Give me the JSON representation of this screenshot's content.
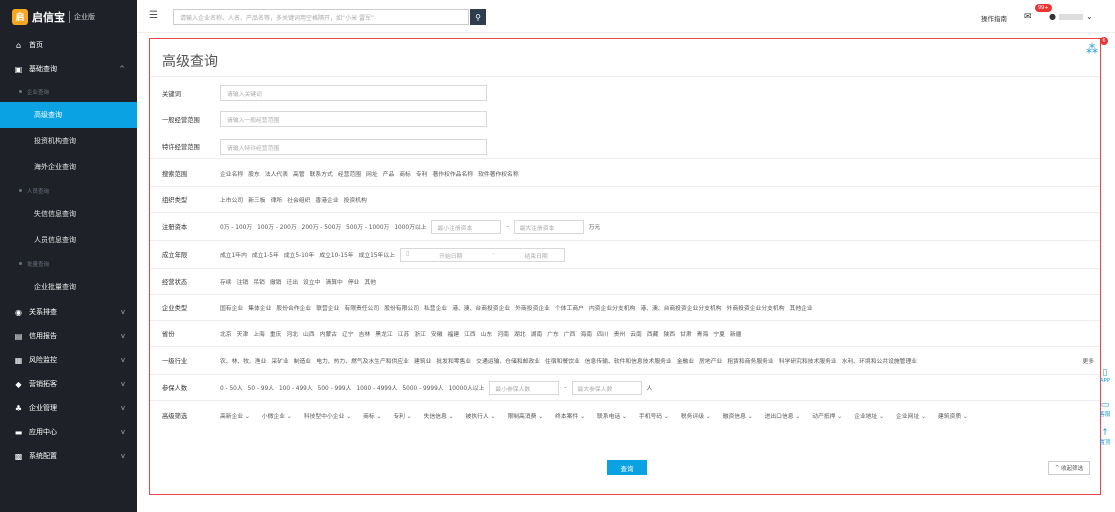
{
  "brand": {
    "name": "启信宝",
    "edition": "企业版",
    "logo": "启"
  },
  "sidebar": {
    "home": "首页",
    "basic": "基础查询",
    "group_company": "企业查询",
    "advanced": "高级查询",
    "investor": "投资机构查询",
    "overseas": "海外企业查询",
    "group_person": "人员查询",
    "dishonest": "失信信息查询",
    "person_info": "人员信息查询",
    "group_batch": "批量查询",
    "batch": "企业批量查询",
    "relation": "关系排查",
    "credit": "信用报告",
    "risk": "风险监控",
    "marketing": "营销拓客",
    "enterprise": "企业管理",
    "apps": "应用中心",
    "config": "系统配置"
  },
  "topbar": {
    "search_placeholder": "请输入企业名称、人名、产品名等，多关键词用空格隔开，如“小米 雷军”",
    "guide": "操作指南",
    "badge": "99+"
  },
  "page": {
    "title": "高级查询",
    "share_badge": "6"
  },
  "fields": {
    "keyword_label": "关键词",
    "keyword_ph": "请输入关键词",
    "scope_label": "一般经营范围",
    "scope_ph": "请输入一般经营范围",
    "license_label": "特许经营范围",
    "license_ph": "请输入特许经营范围"
  },
  "search_range": {
    "label": "搜索范围",
    "options": [
      "企业名称",
      "股东",
      "法人代表",
      "高管",
      "联系方式",
      "经营范围",
      "网址",
      "产品",
      "商标",
      "专利",
      "著作权作品名称",
      "软件著作权名称"
    ]
  },
  "org_type": {
    "label": "组织类型",
    "options": [
      "上市公司",
      "新三板",
      "律所",
      "社会组织",
      "香港企业",
      "投资机构"
    ]
  },
  "capital": {
    "label": "注册资本",
    "options": [
      "0万 - 100万",
      "100万 - 200万",
      "200万 - 500万",
      "500万 - 1000万",
      "1000万以上"
    ],
    "min_ph": "最小注册资本",
    "max_ph": "最大注册资本",
    "unit": "万元"
  },
  "founded": {
    "label": "成立年限",
    "options": [
      "成立1年内",
      "成立1-5年",
      "成立5-10年",
      "成立10-15年",
      "成立15年以上"
    ],
    "start_ph": "开始日期",
    "end_ph": "结束日期"
  },
  "status": {
    "label": "经营状态",
    "options": [
      "存续",
      "注销",
      "吊销",
      "撤销",
      "迁出",
      "设立中",
      "清算中",
      "停业",
      "其他"
    ]
  },
  "ent_type": {
    "label": "企业类型",
    "options": [
      "国有企业",
      "集体企业",
      "股份合作企业",
      "联营企业",
      "有限责任公司",
      "股份有限公司",
      "私营企业",
      "港、澳、台商投资企业",
      "外商投资企业",
      "个体工商户",
      "内资企业分支机构",
      "港、澳、台商投资企业分支机构",
      "外商投资企业分支机构",
      "其他企业"
    ]
  },
  "province": {
    "label": "省份",
    "options": [
      "北京",
      "天津",
      "上海",
      "重庆",
      "河北",
      "山西",
      "内蒙古",
      "辽宁",
      "吉林",
      "黑龙江",
      "江苏",
      "浙江",
      "安徽",
      "福建",
      "江西",
      "山东",
      "河南",
      "湖北",
      "湖南",
      "广东",
      "广西",
      "海南",
      "四川",
      "贵州",
      "云南",
      "西藏",
      "陕西",
      "甘肃",
      "青海",
      "宁夏",
      "新疆"
    ]
  },
  "industry": {
    "label": "一级行业",
    "options": [
      "农、林、牧、渔业",
      "采矿业",
      "制造业",
      "电力、热力、燃气及水生产和供应业",
      "建筑业",
      "批发和零售业",
      "交通运输、仓储和邮政业",
      "住宿和餐饮业",
      "信息传输、软件和信息技术服务业",
      "金融业",
      "房地产业",
      "租赁和商务服务业",
      "科学研究和技术服务业",
      "水利、环境和公共设施管理业"
    ],
    "more": "更多"
  },
  "staff": {
    "label": "参保人数",
    "options": [
      "0 - 50人",
      "50 - 99人",
      "100 - 499人",
      "500 - 999人",
      "1000 - 4999人",
      "5000 - 9999人",
      "10000人以上"
    ],
    "min_ph": "最小参保人数",
    "max_ph": "最大参保人数",
    "unit": "人"
  },
  "advanced": {
    "label": "高级筛选",
    "options": [
      "高新企业",
      "小微企业",
      "科技型中小企业",
      "商标",
      "专利",
      "失信信息",
      "被执行人",
      "限制高消费",
      "终本案件",
      "联系电话",
      "手机号码",
      "税务评级",
      "融资信息",
      "进出口信息",
      "动产抵押",
      "企业地址",
      "企业网址",
      "建筑资质"
    ]
  },
  "buttons": {
    "query": "查询",
    "collapse": "收起筛选"
  },
  "tools": {
    "app": "APP",
    "feedback": "客服",
    "top": "置顶"
  }
}
